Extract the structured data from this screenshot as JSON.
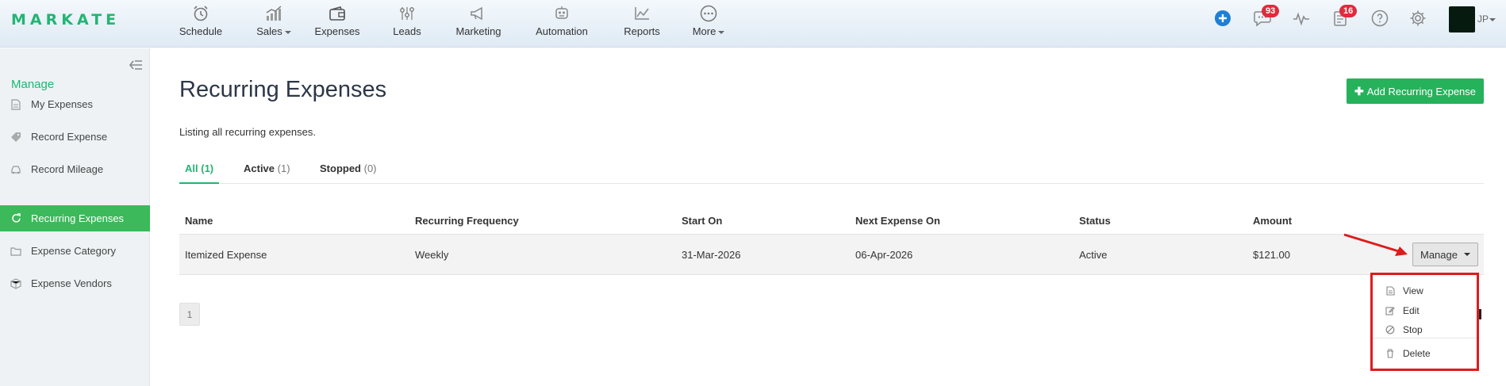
{
  "app": {
    "logo": "MARKATE"
  },
  "nav": {
    "items": [
      {
        "label": "Schedule",
        "icon": "alarm-clock-icon"
      },
      {
        "label": "Sales",
        "icon": "sales-chart-icon",
        "has_caret": true
      },
      {
        "label": "Expenses",
        "icon": "wallet-icon"
      },
      {
        "label": "Leads",
        "icon": "sliders-icon"
      },
      {
        "label": "Marketing",
        "icon": "megaphone-icon"
      },
      {
        "label": "Automation",
        "icon": "robot-icon"
      },
      {
        "label": "Reports",
        "icon": "line-chart-icon"
      },
      {
        "label": "More",
        "icon": "ellipsis-circle-icon",
        "has_caret": true
      }
    ],
    "right": {
      "add_icon": "plus-circle-icon",
      "messages_badge": "93",
      "activity_icon": "pulse-icon",
      "tasks_badge": "16",
      "help_icon": "question-circle-icon",
      "settings_icon": "gear-icon",
      "user_initials": "JP"
    }
  },
  "sidebar": {
    "heading": "Manage",
    "items": [
      {
        "label": "My Expenses",
        "icon": "document-icon"
      },
      {
        "label": "Record Expense",
        "icon": "tag-icon"
      },
      {
        "label": "Record Mileage",
        "icon": "car-icon"
      },
      {
        "label": "Recurring Expenses",
        "icon": "refresh-icon",
        "active": true
      },
      {
        "label": "Expense Category",
        "icon": "folder-icon"
      },
      {
        "label": "Expense Vendors",
        "icon": "box-icon"
      }
    ]
  },
  "main": {
    "title": "Recurring Expenses",
    "add_button": "Add Recurring Expense",
    "subtitle": "Listing all recurring expenses.",
    "tabs": [
      {
        "label": "All",
        "count": "(1)",
        "active": true
      },
      {
        "label": "Active",
        "count": "(1)"
      },
      {
        "label": "Stopped",
        "count": "(0)"
      }
    ],
    "table": {
      "headers": [
        "Name",
        "Recurring Frequency",
        "Start On",
        "Next Expense On",
        "Status",
        "Amount"
      ],
      "rows": [
        [
          "Itemized Expense",
          "Weekly",
          "31-Mar-2026",
          "06-Apr-2026",
          "Active",
          "$121.00"
        ]
      ]
    },
    "manage_button": "Manage",
    "pagination": {
      "current": "1"
    },
    "dropdown": [
      {
        "label": "View",
        "icon": "file-icon"
      },
      {
        "label": "Edit",
        "icon": "edit-icon"
      },
      {
        "label": "Stop",
        "icon": "ban-icon"
      },
      {
        "label": "Delete",
        "icon": "trash-icon"
      }
    ]
  },
  "colors": {
    "brand": "#22b573",
    "active_sidebar": "#3cb95a",
    "button_green": "#25b25b",
    "badge_red": "#e02b3c",
    "annotation_red": "#e01b1b"
  }
}
